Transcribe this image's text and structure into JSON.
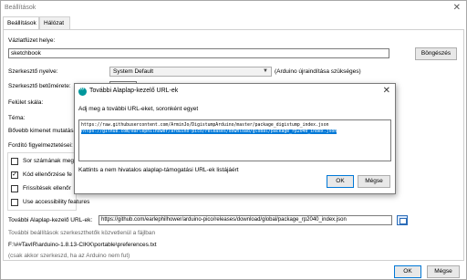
{
  "window": {
    "title": "Beállítások",
    "close_glyph": "✕"
  },
  "tabs": [
    {
      "label": "Beállítások"
    },
    {
      "label": "Hálózat"
    }
  ],
  "sketchbook": {
    "label": "Vázlatfüzet helye:",
    "value": "sketchbook",
    "browse": "Böngészés"
  },
  "language": {
    "label": "Szerkesztő nyelve:",
    "value": "System Default",
    "note": "(Arduino újraindítása szükséges)"
  },
  "font_size": {
    "label": "Szerkesztő betűmérete:"
  },
  "scale": {
    "label": "Felület skála:"
  },
  "theme": {
    "label": "Téma:"
  },
  "verbose": {
    "label": "Bővebb kimenet mutatása:"
  },
  "warnings": {
    "label": "Fordító figyelmeztetései:"
  },
  "checkboxes": [
    {
      "label": "Sor számának meg",
      "checked": false
    },
    {
      "label": "Kód ellenőrzése fe",
      "checked": true
    },
    {
      "label": "Frissítések ellenőr",
      "checked": false
    },
    {
      "label": "Use accessibility features",
      "checked": false
    }
  ],
  "board_urls": {
    "label": "További Alaplap-kezelő URL-ek:",
    "value": "https://github.com/earlephilhower/arduino-pico/releases/download/global/package_rp2040_index.json",
    "icon": "url-editor-icon"
  },
  "more_prefs": "További beállítások szerkeszthetők közvetlenül a fájlban",
  "prefs_path": "F:\\##TavIR\\arduino-1.8.13-CIKK\\portable\\preferences.txt",
  "edit_note": "(csak akkor szerkeszd, ha az Arduino nem fut)",
  "footer": {
    "ok": "OK",
    "cancel": "Mégse"
  },
  "dialog": {
    "title": "További Alaplap-kezelő URL-ek",
    "icon": "arduino-icon",
    "close_glyph": "✕",
    "prompt": "Adj meg a további URL-eket, soronként egyet",
    "urls": [
      "https://raw.githubusercontent.com/ArminJo/DigistumpArduino/master/package_digistump_index.json",
      "https://github.com/earlephilhower/arduino-pico/releases/download/global/package_rp2040_index.json"
    ],
    "link": "Kattints a nem hivatalos alaplap-támogatási URL-ek listájáért",
    "ok": "OK",
    "cancel": "Mégse"
  },
  "colors": {
    "selection": "#0078d7",
    "link": "#000000",
    "arduino": "#00979c"
  }
}
